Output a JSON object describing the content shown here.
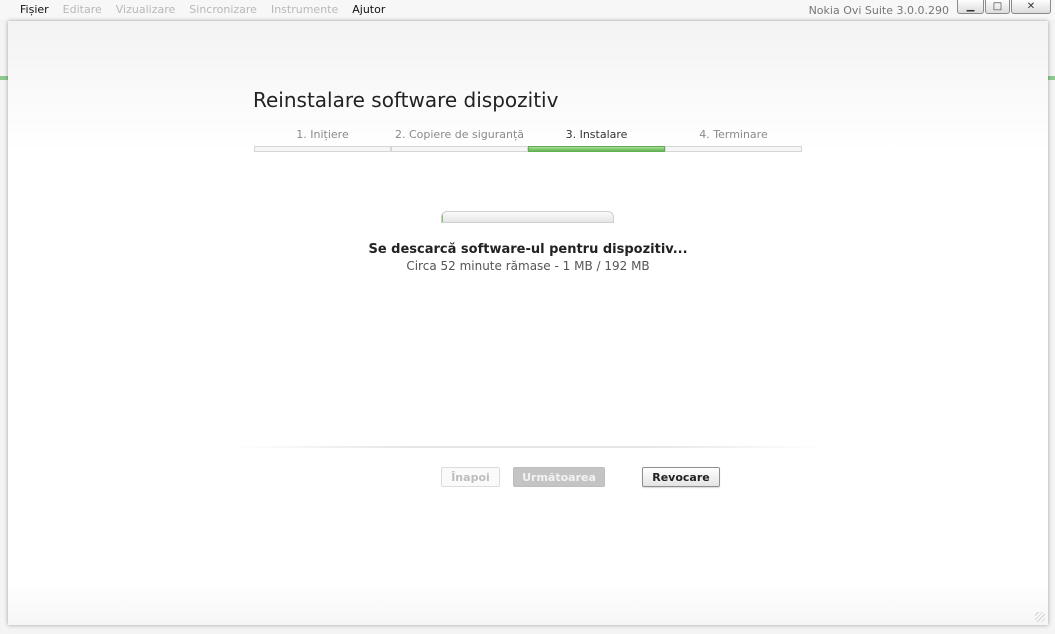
{
  "menu": {
    "items": [
      {
        "label": "Fișier",
        "enabled": true
      },
      {
        "label": "Editare",
        "enabled": false
      },
      {
        "label": "Vizualizare",
        "enabled": false
      },
      {
        "label": "Sincronizare",
        "enabled": false
      },
      {
        "label": "Instrumente",
        "enabled": false
      },
      {
        "label": "Ajutor",
        "enabled": true
      }
    ]
  },
  "app_title": "Nokia Ovi Suite 3.0.0.290",
  "window_controls": {
    "minimize": "▁",
    "maximize": "□",
    "close": "✕"
  },
  "dialog": {
    "title": "Reinstalare software dispozitiv",
    "steps": [
      {
        "label": "1. Inițiere",
        "active": false
      },
      {
        "label": "2. Copiere de siguranță",
        "active": false
      },
      {
        "label": "3. Instalare",
        "active": true
      },
      {
        "label": "4. Terminare",
        "active": false
      }
    ],
    "progress_fraction": 0.005,
    "status_main": "Se descarcă software-ul pentru dispozitiv...",
    "status_sub": "Circa 52 minute rămase - 1 MB / 192 MB",
    "buttons": {
      "back": "Înapoi",
      "next": "Următoarea",
      "cancel": "Revocare"
    }
  },
  "colors": {
    "accent_green": "#63b552",
    "disabled_text": "#bdbdbd"
  }
}
